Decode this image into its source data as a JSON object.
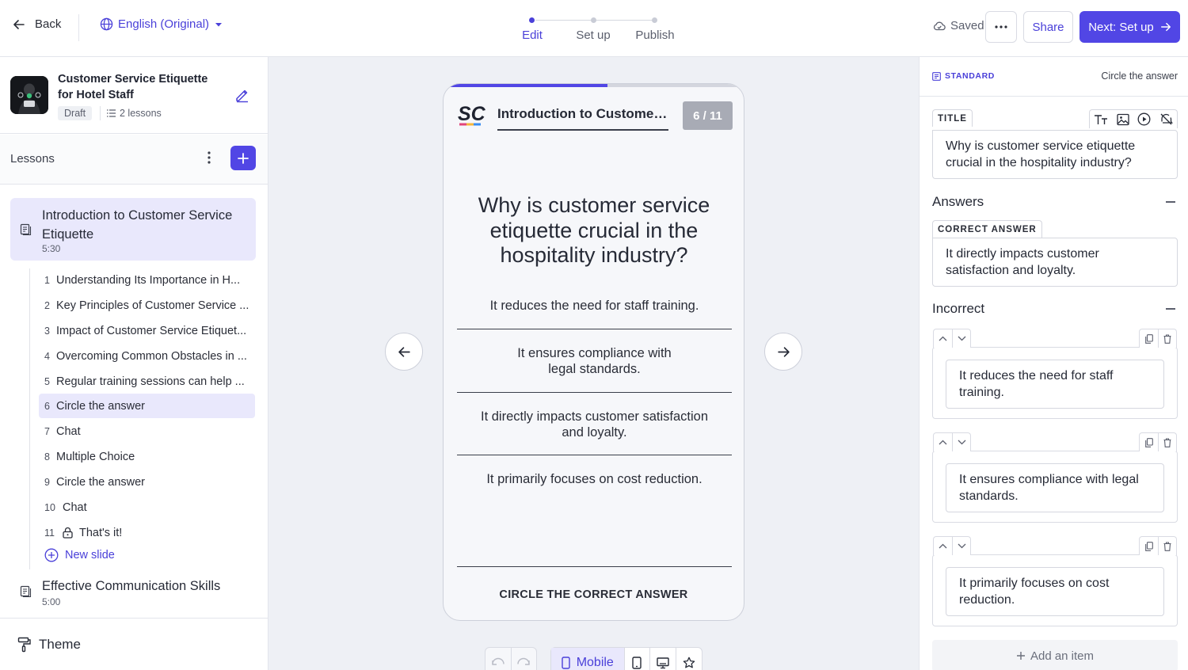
{
  "colors": {
    "accent": "#5146e5",
    "accent_text": "#4a40d9",
    "selected_bg": "#e9e8fc",
    "canvas_bg": "#eef0f5"
  },
  "topbar": {
    "back_label": "Back",
    "language": "English (Original)",
    "steps": [
      {
        "label": "Edit",
        "active": true
      },
      {
        "label": "Set up",
        "active": false
      },
      {
        "label": "Publish",
        "active": false
      }
    ],
    "saved_label": "Saved",
    "share_label": "Share",
    "next_label": "Next: Set up"
  },
  "course": {
    "title": "Customer Service Etiquette for Hotel Staff",
    "status": "Draft",
    "lesson_count": "2 lessons"
  },
  "lessons_header": "Lessons",
  "lessons": [
    {
      "title": "Introduction to Customer Service Etiquette",
      "duration": "5:30",
      "slides": [
        {
          "num": "1",
          "title": "Understanding Its Importance in H..."
        },
        {
          "num": "2",
          "title": "Key Principles of Customer Service ..."
        },
        {
          "num": "3",
          "title": "Impact of Customer Service Etiquet..."
        },
        {
          "num": "4",
          "title": "Overcoming Common Obstacles in ..."
        },
        {
          "num": "5",
          "title": "Regular training sessions can help ..."
        },
        {
          "num": "6",
          "title": "Circle the answer",
          "active": true
        },
        {
          "num": "7",
          "title": "Chat"
        },
        {
          "num": "8",
          "title": "Multiple Choice"
        },
        {
          "num": "9",
          "title": "Circle the answer"
        },
        {
          "num": "10",
          "title": "Chat"
        },
        {
          "num": "11",
          "title": "That's it!",
          "locked": true
        }
      ],
      "new_slide_label": "New slide"
    },
    {
      "title": "Effective Communication Skills",
      "duration": "5:00"
    }
  ],
  "theme_label": "Theme",
  "preview": {
    "logo_text": "SC",
    "lesson_title": "Introduction to Customer Service Etiquette",
    "counter": "6 / 11",
    "progress_fraction": 0.545,
    "question": "Why is customer service etiquette crucial in the hospitality industry?",
    "options": [
      "It reduces the need for staff training.",
      "It ensures compliance with legal standards.",
      "It directly impacts customer satisfaction and loyalty.",
      "It primarily focuses on cost reduction."
    ],
    "caption": "CIRCLE THE CORRECT ANSWER"
  },
  "device_toolbar": {
    "mobile_label": "Mobile"
  },
  "editor": {
    "type_badge": "STANDARD",
    "slide_type": "Circle the answer",
    "title_tag": "TITLE",
    "title_value": "Why is customer service etiquette crucial in the hospitality industry?",
    "answers_heading": "Answers",
    "correct_tag": "CORRECT ANSWER",
    "correct_value": "It directly impacts customer satisfaction and loyalty.",
    "incorrect_heading": "Incorrect",
    "incorrect": [
      "It reduces the need for staff training.",
      "It ensures compliance with legal standards.",
      "It primarily focuses on cost reduction."
    ],
    "add_item_label": "Add an item"
  }
}
